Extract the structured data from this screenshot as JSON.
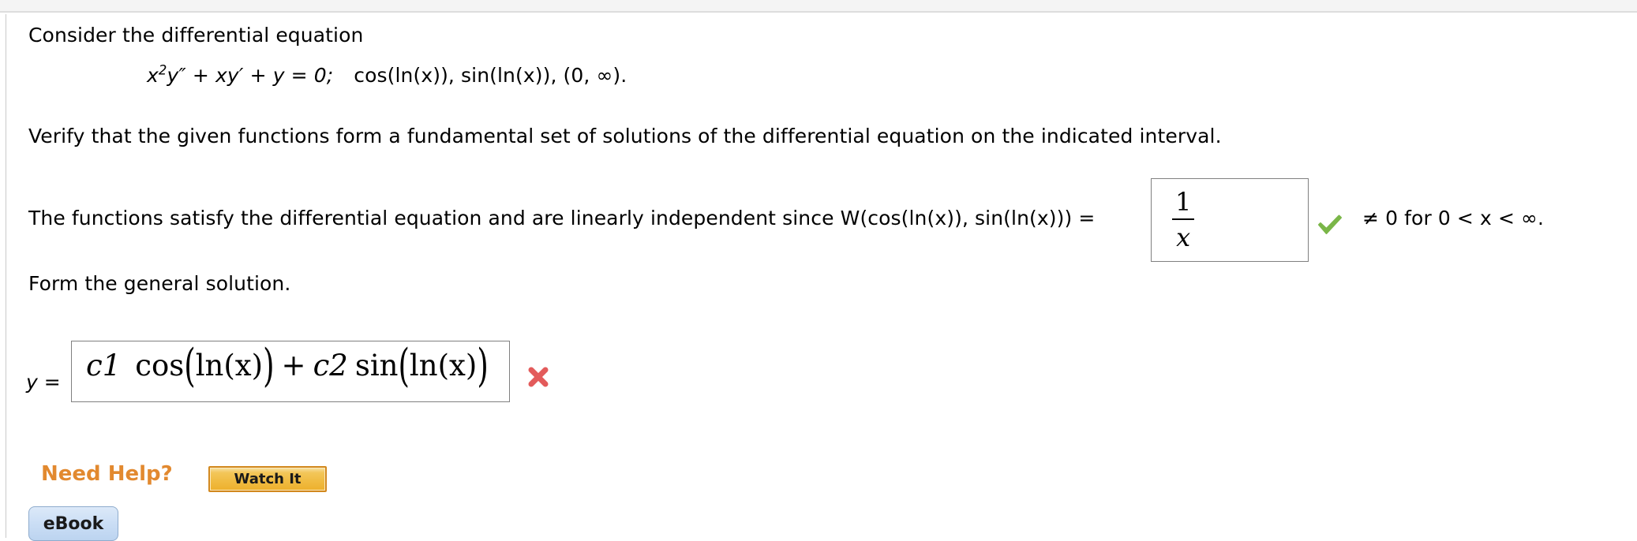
{
  "page": {
    "background_color": "#ffffff",
    "top_strip_color": "#f4f4f4"
  },
  "problem": {
    "prompt": "Consider the differential equation",
    "equation": {
      "lhs_base": "x",
      "lhs_exponent": "2",
      "lhs_rest": "y″ + xy′ + y = 0;",
      "given_functions": "cos(ln(x)), sin(ln(x)), (0, ∞)."
    },
    "instruction": "Verify that the given functions form a fundamental set of solutions of the differential equation on the indicated interval."
  },
  "wronskian": {
    "lead_text": "The functions satisfy the differential equation and are linearly independent since W(cos(ln(x)), sin(ln(x))) =",
    "answer_numerator": "1",
    "answer_denominator": "x",
    "answer_plain": "1/x",
    "status": "correct",
    "status_icon": "green-check-icon",
    "status_color": "#7ab648",
    "tail_text": "≠ 0 for 0 < x < ∞."
  },
  "general_solution": {
    "heading": "Form the general solution.",
    "y_label": "y =",
    "answer_plain": "c1 cos(ln(x)) + c2 sin(ln(x))",
    "answer_tokens": {
      "c1": "c1",
      "cos": "cos",
      "ln_x_1": "ln(x)",
      "plus": "+",
      "c2": "c2",
      "sin": "sin",
      "ln_x_2": "ln(x)"
    },
    "status": "incorrect",
    "status_icon": "red-x-icon",
    "status_color": "#e35b5b"
  },
  "help": {
    "label": "Need Help?",
    "label_color": "#e2892f",
    "watch_it_label": "Watch It",
    "watch_it_color": "#f0bb41",
    "ebook_label": "eBook",
    "ebook_color": "#cbdef5"
  }
}
